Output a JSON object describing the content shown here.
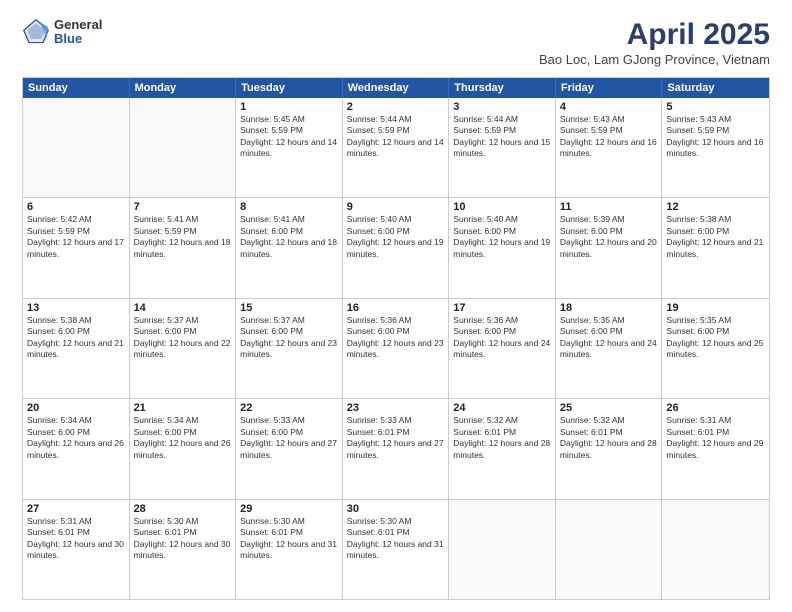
{
  "logo": {
    "general": "General",
    "blue": "Blue"
  },
  "title": {
    "month": "April 2025",
    "location": "Bao Loc, Lam GJong Province, Vietnam"
  },
  "header_days": [
    "Sunday",
    "Monday",
    "Tuesday",
    "Wednesday",
    "Thursday",
    "Friday",
    "Saturday"
  ],
  "weeks": [
    [
      {
        "day": "",
        "empty": true
      },
      {
        "day": "",
        "empty": true
      },
      {
        "day": "1",
        "sunrise": "5:45 AM",
        "sunset": "5:59 PM",
        "daylight": "12 hours and 14 minutes."
      },
      {
        "day": "2",
        "sunrise": "5:44 AM",
        "sunset": "5:59 PM",
        "daylight": "12 hours and 14 minutes."
      },
      {
        "day": "3",
        "sunrise": "5:44 AM",
        "sunset": "5:59 PM",
        "daylight": "12 hours and 15 minutes."
      },
      {
        "day": "4",
        "sunrise": "5:43 AM",
        "sunset": "5:59 PM",
        "daylight": "12 hours and 16 minutes."
      },
      {
        "day": "5",
        "sunrise": "5:43 AM",
        "sunset": "5:59 PM",
        "daylight": "12 hours and 16 minutes."
      }
    ],
    [
      {
        "day": "6",
        "sunrise": "5:42 AM",
        "sunset": "5:59 PM",
        "daylight": "12 hours and 17 minutes."
      },
      {
        "day": "7",
        "sunrise": "5:41 AM",
        "sunset": "5:59 PM",
        "daylight": "12 hours and 18 minutes."
      },
      {
        "day": "8",
        "sunrise": "5:41 AM",
        "sunset": "6:00 PM",
        "daylight": "12 hours and 18 minutes."
      },
      {
        "day": "9",
        "sunrise": "5:40 AM",
        "sunset": "6:00 PM",
        "daylight": "12 hours and 19 minutes."
      },
      {
        "day": "10",
        "sunrise": "5:40 AM",
        "sunset": "6:00 PM",
        "daylight": "12 hours and 19 minutes."
      },
      {
        "day": "11",
        "sunrise": "5:39 AM",
        "sunset": "6:00 PM",
        "daylight": "12 hours and 20 minutes."
      },
      {
        "day": "12",
        "sunrise": "5:38 AM",
        "sunset": "6:00 PM",
        "daylight": "12 hours and 21 minutes."
      }
    ],
    [
      {
        "day": "13",
        "sunrise": "5:38 AM",
        "sunset": "6:00 PM",
        "daylight": "12 hours and 21 minutes."
      },
      {
        "day": "14",
        "sunrise": "5:37 AM",
        "sunset": "6:00 PM",
        "daylight": "12 hours and 22 minutes."
      },
      {
        "day": "15",
        "sunrise": "5:37 AM",
        "sunset": "6:00 PM",
        "daylight": "12 hours and 23 minutes."
      },
      {
        "day": "16",
        "sunrise": "5:36 AM",
        "sunset": "6:00 PM",
        "daylight": "12 hours and 23 minutes."
      },
      {
        "day": "17",
        "sunrise": "5:36 AM",
        "sunset": "6:00 PM",
        "daylight": "12 hours and 24 minutes."
      },
      {
        "day": "18",
        "sunrise": "5:35 AM",
        "sunset": "6:00 PM",
        "daylight": "12 hours and 24 minutes."
      },
      {
        "day": "19",
        "sunrise": "5:35 AM",
        "sunset": "6:00 PM",
        "daylight": "12 hours and 25 minutes."
      }
    ],
    [
      {
        "day": "20",
        "sunrise": "5:34 AM",
        "sunset": "6:00 PM",
        "daylight": "12 hours and 26 minutes."
      },
      {
        "day": "21",
        "sunrise": "5:34 AM",
        "sunset": "6:00 PM",
        "daylight": "12 hours and 26 minutes."
      },
      {
        "day": "22",
        "sunrise": "5:33 AM",
        "sunset": "6:00 PM",
        "daylight": "12 hours and 27 minutes."
      },
      {
        "day": "23",
        "sunrise": "5:33 AM",
        "sunset": "6:01 PM",
        "daylight": "12 hours and 27 minutes."
      },
      {
        "day": "24",
        "sunrise": "5:32 AM",
        "sunset": "6:01 PM",
        "daylight": "12 hours and 28 minutes."
      },
      {
        "day": "25",
        "sunrise": "5:32 AM",
        "sunset": "6:01 PM",
        "daylight": "12 hours and 28 minutes."
      },
      {
        "day": "26",
        "sunrise": "5:31 AM",
        "sunset": "6:01 PM",
        "daylight": "12 hours and 29 minutes."
      }
    ],
    [
      {
        "day": "27",
        "sunrise": "5:31 AM",
        "sunset": "6:01 PM",
        "daylight": "12 hours and 30 minutes."
      },
      {
        "day": "28",
        "sunrise": "5:30 AM",
        "sunset": "6:01 PM",
        "daylight": "12 hours and 30 minutes."
      },
      {
        "day": "29",
        "sunrise": "5:30 AM",
        "sunset": "6:01 PM",
        "daylight": "12 hours and 31 minutes."
      },
      {
        "day": "30",
        "sunrise": "5:30 AM",
        "sunset": "6:01 PM",
        "daylight": "12 hours and 31 minutes."
      },
      {
        "day": "",
        "empty": true
      },
      {
        "day": "",
        "empty": true
      },
      {
        "day": "",
        "empty": true
      }
    ]
  ]
}
